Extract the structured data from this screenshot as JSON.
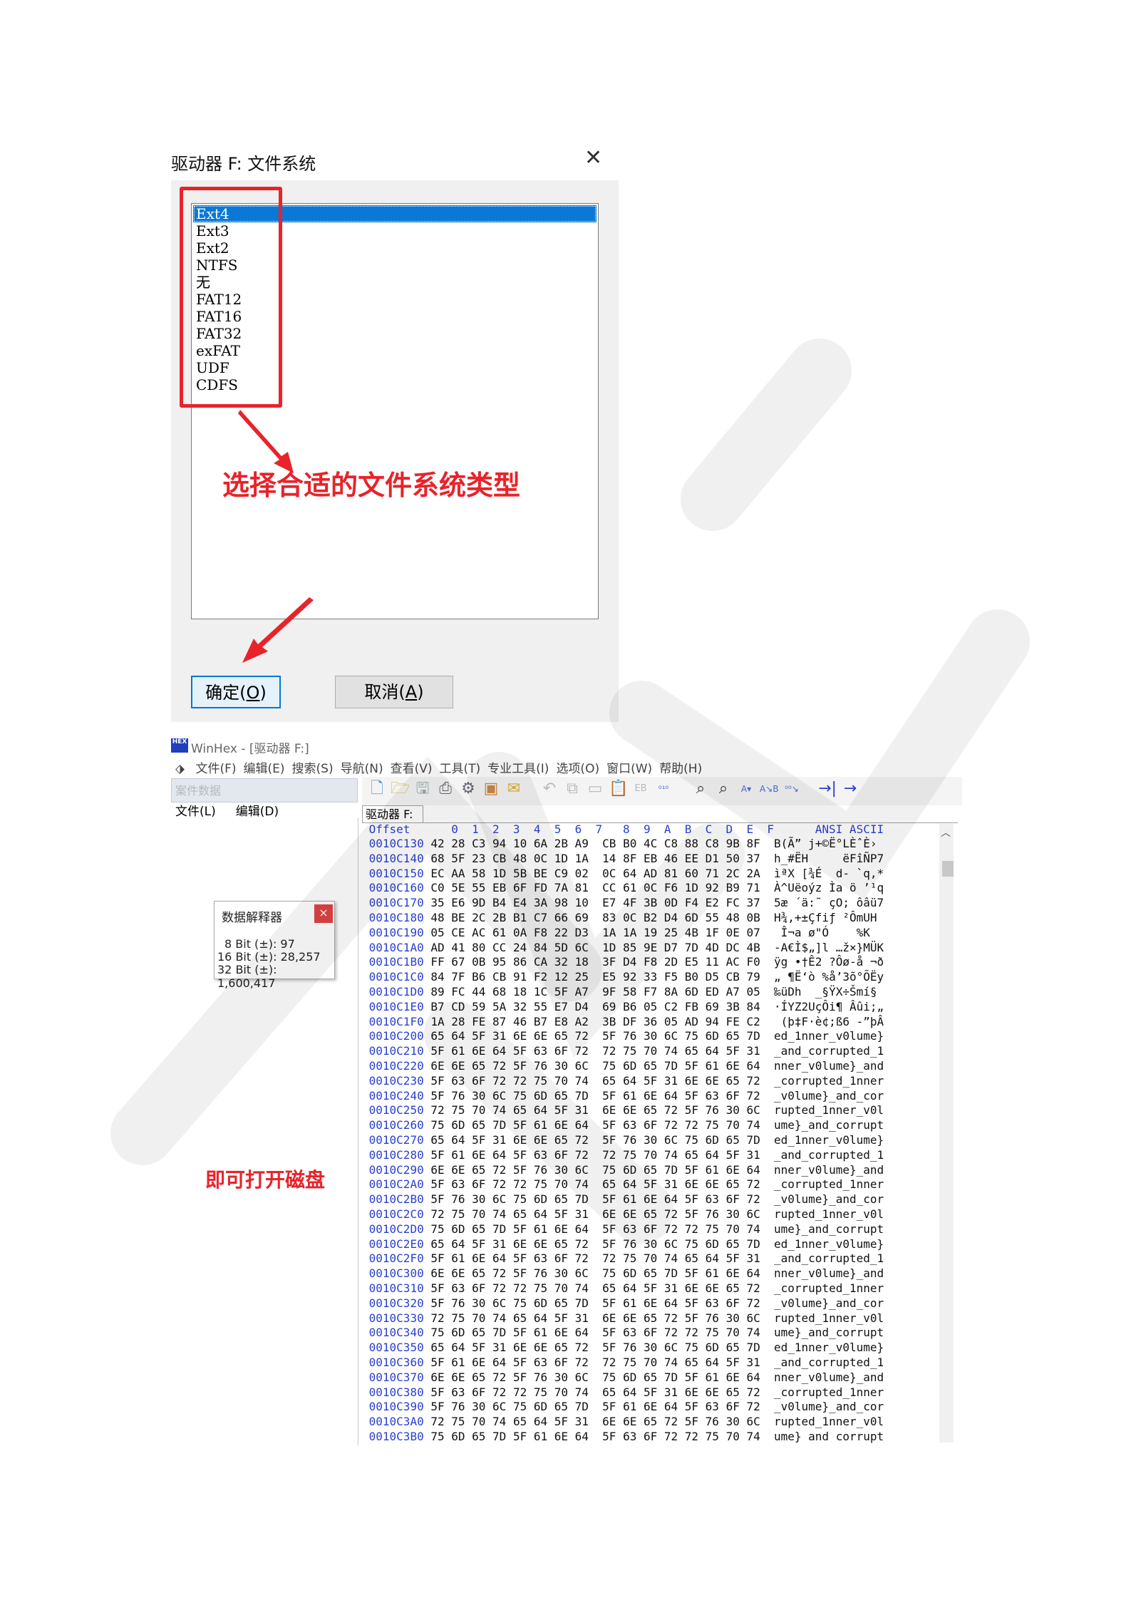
{
  "dialog": {
    "title": "驱动器 F: 文件系统",
    "close_glyph": "✕",
    "options": [
      "Ext4",
      "Ext3",
      "Ext2",
      "NTFS",
      "无",
      "FAT12",
      "FAT16",
      "FAT32",
      "exFAT",
      "UDF",
      "CDFS"
    ],
    "selected": "Ext4",
    "annotation": "选择合适的文件系统类型",
    "ok_label": "确定(",
    "ok_key": "O",
    "ok_tail": ")",
    "cancel_label": "取消(",
    "cancel_key": "A",
    "cancel_tail": ")"
  },
  "winhex": {
    "logo": "HEX",
    "title": "WinHex - [驱动器 F:]",
    "menu": [
      "文件(F)",
      "编辑(E)",
      "搜索(S)",
      "导航(N)",
      "查看(V)",
      "工具(T)",
      "专业工具(I)",
      "选项(O)",
      "窗口(W)",
      "帮助(H)"
    ],
    "left_panel_title": "案件数据",
    "left_panel_menu": [
      "文件(L)",
      "编辑(D)"
    ],
    "tab": "驱动器 F:",
    "hex_header": " Offset      0  1  2  3  4  5  6  7   8  9  A  B  C  D  E  F      ANSI ASCII",
    "rows": [
      [
        "0010C130",
        "42 28 C3 94 10 6A 2B A9",
        "CB B0 4C C8 88 C8 9B 8F",
        "B(Ã” j+©Ë°LÈˆÈ›"
      ],
      [
        "0010C140",
        "68 5F 23 CB 48 0C 1D 1A",
        "14 8F EB 46 EE D1 50 37",
        "h_#ËH     ëFîÑP7"
      ],
      [
        "0010C150",
        "EC AA 58 1D 5B BE C9 02",
        "0C 64 AD 81 60 71 2C 2A",
        "ìªX [¾É  d- `q,*"
      ],
      [
        "0010C160",
        "C0 5E 55 EB 6F FD 7A 81",
        "CC 61 0C F6 1D 92 B9 71",
        "À^Uëoýz Ìa ö ’¹q"
      ],
      [
        "0010C170",
        "35 E6 9D B4 E4 3A 98 10",
        "E7 4F 3B 0D F4 E2 FC 37",
        "5æ ´ä:˜ çO; ôâü7"
      ],
      [
        "0010C180",
        "48 BE 2C 2B B1 C7 66 69",
        "83 0C B2 D4 6D 55 48 0B",
        "H¾,+±Çfiƒ ²ÔmUH"
      ],
      [
        "0010C190",
        "05 CE AC 61 0A F8 22 D3",
        "1A 1A 19 25 4B 1F 0E 07",
        " Î¬a ø\"Ó    %K"
      ],
      [
        "0010C1A0",
        "AD 41 80 CC 24 84 5D 6C",
        "1D 85 9E D7 7D 4D DC 4B",
        "-A€Ì$„]l …ž×}MÜK"
      ],
      [
        "0010C1B0",
        "FF 67 0B 95 86 CA 32 18",
        "3F D4 F8 2D E5 11 AC F0",
        "ÿg •†Ê2 ?Ôø-å ¬ð"
      ],
      [
        "0010C1C0",
        "84 7F B6 CB 91 F2 12 25",
        "E5 92 33 F5 B0 D5 CB 79",
        "„ ¶Ë‘ò %å’3õ°ÕËy"
      ],
      [
        "0010C1D0",
        "89 FC 44 68 18 1C 5F A7",
        "9F 58 F7 8A 6D ED A7 05",
        "‰üDh  _§ŸX÷Šmí§"
      ],
      [
        "0010C1E0",
        "B7 CD 59 5A 32 55 E7 D4",
        "69 B6 05 C2 FB 69 3B 84",
        "·ÍYZ2UçÔi¶ Âûi;„"
      ],
      [
        "0010C1F0",
        "1A 28 FE 87 46 B7 E8 A2",
        "3B DF 36 05 AD 94 FE C2",
        " (þ‡F·è¢;ß6 -”þÂ"
      ],
      [
        "0010C200",
        "65 64 5F 31 6E 6E 65 72",
        "5F 76 30 6C 75 6D 65 7D",
        "ed_1nner_v0lume}"
      ],
      [
        "0010C210",
        "5F 61 6E 64 5F 63 6F 72",
        "72 75 70 74 65 64 5F 31",
        "_and_corrupted_1"
      ],
      [
        "0010C220",
        "6E 6E 65 72 5F 76 30 6C",
        "75 6D 65 7D 5F 61 6E 64",
        "nner_v0lume}_and"
      ],
      [
        "0010C230",
        "5F 63 6F 72 72 75 70 74",
        "65 64 5F 31 6E 6E 65 72",
        "_corrupted_1nner"
      ],
      [
        "0010C240",
        "5F 76 30 6C 75 6D 65 7D",
        "5F 61 6E 64 5F 63 6F 72",
        "_v0lume}_and_cor"
      ],
      [
        "0010C250",
        "72 75 70 74 65 64 5F 31",
        "6E 6E 65 72 5F 76 30 6C",
        "rupted_1nner_v0l"
      ],
      [
        "0010C260",
        "75 6D 65 7D 5F 61 6E 64",
        "5F 63 6F 72 72 75 70 74",
        "ume}_and_corrupt"
      ],
      [
        "0010C270",
        "65 64 5F 31 6E 6E 65 72",
        "5F 76 30 6C 75 6D 65 7D",
        "ed_1nner_v0lume}"
      ],
      [
        "0010C280",
        "5F 61 6E 64 5F 63 6F 72",
        "72 75 70 74 65 64 5F 31",
        "_and_corrupted_1"
      ],
      [
        "0010C290",
        "6E 6E 65 72 5F 76 30 6C",
        "75 6D 65 7D 5F 61 6E 64",
        "nner_v0lume}_and"
      ],
      [
        "0010C2A0",
        "5F 63 6F 72 72 75 70 74",
        "65 64 5F 31 6E 6E 65 72",
        "_corrupted_1nner"
      ],
      [
        "0010C2B0",
        "5F 76 30 6C 75 6D 65 7D",
        "5F 61 6E 64 5F 63 6F 72",
        "_v0lume}_and_cor"
      ],
      [
        "0010C2C0",
        "72 75 70 74 65 64 5F 31",
        "6E 6E 65 72 5F 76 30 6C",
        "rupted_1nner_v0l"
      ],
      [
        "0010C2D0",
        "75 6D 65 7D 5F 61 6E 64",
        "5F 63 6F 72 72 75 70 74",
        "ume}_and_corrupt"
      ],
      [
        "0010C2E0",
        "65 64 5F 31 6E 6E 65 72",
        "5F 76 30 6C 75 6D 65 7D",
        "ed_1nner_v0lume}"
      ],
      [
        "0010C2F0",
        "5F 61 6E 64 5F 63 6F 72",
        "72 75 70 74 65 64 5F 31",
        "_and_corrupted_1"
      ],
      [
        "0010C300",
        "6E 6E 65 72 5F 76 30 6C",
        "75 6D 65 7D 5F 61 6E 64",
        "nner_v0lume}_and"
      ],
      [
        "0010C310",
        "5F 63 6F 72 72 75 70 74",
        "65 64 5F 31 6E 6E 65 72",
        "_corrupted_1nner"
      ],
      [
        "0010C320",
        "5F 76 30 6C 75 6D 65 7D",
        "5F 61 6E 64 5F 63 6F 72",
        "_v0lume}_and_cor"
      ],
      [
        "0010C330",
        "72 75 70 74 65 64 5F 31",
        "6E 6E 65 72 5F 76 30 6C",
        "rupted_1nner_v0l"
      ],
      [
        "0010C340",
        "75 6D 65 7D 5F 61 6E 64",
        "5F 63 6F 72 72 75 70 74",
        "ume}_and_corrupt"
      ],
      [
        "0010C350",
        "65 64 5F 31 6E 6E 65 72",
        "5F 76 30 6C 75 6D 65 7D",
        "ed_1nner_v0lume}"
      ],
      [
        "0010C360",
        "5F 61 6E 64 5F 63 6F 72",
        "72 75 70 74 65 64 5F 31",
        "_and_corrupted_1"
      ],
      [
        "0010C370",
        "6E 6E 65 72 5F 76 30 6C",
        "75 6D 65 7D 5F 61 6E 64",
        "nner_v0lume}_and"
      ],
      [
        "0010C380",
        "5F 63 6F 72 72 75 70 74",
        "65 64 5F 31 6E 6E 65 72",
        "_corrupted_1nner"
      ],
      [
        "0010C390",
        "5F 76 30 6C 75 6D 65 7D",
        "5F 61 6E 64 5F 63 6F 72",
        "_v0lume}_and_cor"
      ],
      [
        "0010C3A0",
        "72 75 70 74 65 64 5F 31",
        "6E 6E 65 72 5F 76 30 6C",
        "rupted_1nner_v0l"
      ],
      [
        "0010C3B0",
        "75 6D 65 7D 5F 61 6E 64",
        "5F 63 6F 72 72 75 70 74",
        "ume} and corrupt"
      ]
    ],
    "interpreter": {
      "title": "数据解释器",
      "close_glyph": "×",
      "lines": [
        "8 Bit (±): 97",
        "16 Bit (±): 28,257",
        "32 Bit (±): 1,600,417"
      ]
    },
    "annotation": "即可打开磁盘"
  },
  "colors": {
    "annotation_red": "#e8232a",
    "selection_blue": "#0a78d7",
    "offset_blue": "#2a3fd0"
  }
}
